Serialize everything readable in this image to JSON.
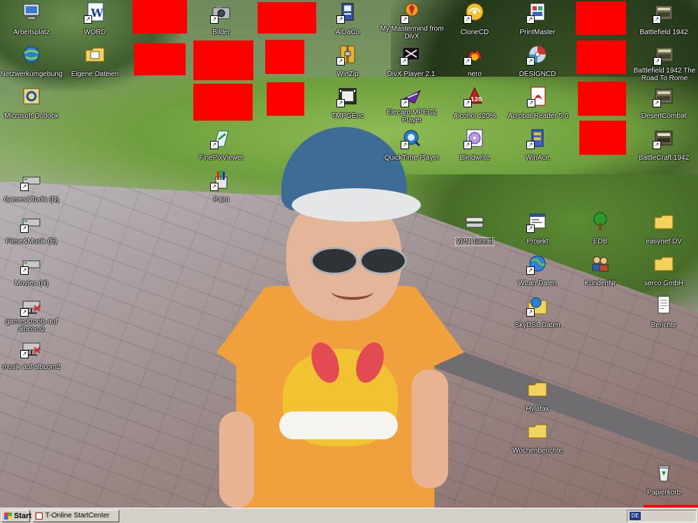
{
  "desktop": {
    "icons": [
      {
        "id": "arbeitsplatz",
        "label": "Arbeitsplatz",
        "icon": "computer-icon",
        "shortcut": false
      },
      {
        "id": "word",
        "label": "WORD",
        "icon": "word-icon",
        "shortcut": true
      },
      {
        "id": "bilder",
        "label": "Bilder",
        "icon": "camera-icon",
        "shortcut": true
      },
      {
        "id": "aldaco",
        "label": "AlDaCo",
        "icon": "app-icon",
        "shortcut": true
      },
      {
        "id": "mastermind",
        "label": "My Mastermind from DivX",
        "icon": "mastermind-icon",
        "shortcut": true
      },
      {
        "id": "clonecd",
        "label": "CloneCD",
        "icon": "clonecd-icon",
        "shortcut": true
      },
      {
        "id": "printmaster",
        "label": "PrintMaster",
        "icon": "printmaster-icon",
        "shortcut": true
      },
      {
        "id": "battlefield1942",
        "label": "Battlefield 1942",
        "icon": "game-icon",
        "shortcut": true
      },
      {
        "id": "netzwerk",
        "label": "Netzwerkumgebung",
        "icon": "network-icon",
        "shortcut": false
      },
      {
        "id": "eigene",
        "label": "Eigene Dateien",
        "icon": "folder-documents-icon",
        "shortcut": false
      },
      {
        "id": "winzip",
        "label": "WinZip",
        "icon": "winzip-icon",
        "shortcut": true
      },
      {
        "id": "divxplayer",
        "label": "DivX Player 2.1",
        "icon": "divx-player-icon",
        "shortcut": true
      },
      {
        "id": "nero",
        "label": "nero",
        "icon": "nero-icon",
        "shortcut": true
      },
      {
        "id": "designcd",
        "label": "DESIGNCD",
        "icon": "cd-icon",
        "shortcut": true
      },
      {
        "id": "bf_road",
        "label": "Battlefield 1942 The Road To Rome",
        "icon": "game-icon",
        "shortcut": true
      },
      {
        "id": "outlook",
        "label": "Microsoft Outlook",
        "icon": "outlook-icon",
        "shortcut": false
      },
      {
        "id": "tmpgenc",
        "label": "TMPGEnc",
        "icon": "film-icon",
        "shortcut": true
      },
      {
        "id": "elecard",
        "label": "Elecard MPEG2 Player",
        "icon": "elecard-icon",
        "shortcut": true
      },
      {
        "id": "alcohol",
        "label": "Alcohol 120%",
        "icon": "alcohol-icon",
        "shortcut": true
      },
      {
        "id": "acrobat",
        "label": "Acrobat Reader 5.0",
        "icon": "acrobat-icon",
        "shortcut": true
      },
      {
        "id": "desertcombat",
        "label": "DesertCombat",
        "icon": "game-icon",
        "shortcut": true
      },
      {
        "id": "finepix",
        "label": "FinePixViewer",
        "icon": "finepix-icon",
        "shortcut": true
      },
      {
        "id": "quicktime",
        "label": "QuickTime Player",
        "icon": "quicktime-icon",
        "shortcut": true
      },
      {
        "id": "blindwrite",
        "label": "Blindwrite",
        "icon": "blindwrite-icon",
        "shortcut": true
      },
      {
        "id": "winace",
        "label": "WinAce",
        "icon": "winace-icon",
        "shortcut": true
      },
      {
        "id": "battlecraft",
        "label": "BattleCraft 1942",
        "icon": "game-icon",
        "shortcut": true
      },
      {
        "id": "paint",
        "label": "Paint",
        "icon": "paint-icon",
        "shortcut": true
      },
      {
        "id": "gamestools",
        "label": "Games&Tools (D)",
        "icon": "drive-icon",
        "shortcut": true
      },
      {
        "id": "vpn",
        "label": "VPN Tunnel",
        "icon": "vpn-icon",
        "shortcut": false
      },
      {
        "id": "projekt",
        "label": "Projekt",
        "icon": "window-icon",
        "shortcut": true
      },
      {
        "id": "edb",
        "label": "EDB",
        "icon": "tree-icon",
        "shortcut": false
      },
      {
        "id": "easynet",
        "label": "easynet DV",
        "icon": "folder-icon",
        "shortcut": false
      },
      {
        "id": "filmemusik",
        "label": "Filme&Musik (E)",
        "icon": "drive-icon",
        "shortcut": true
      },
      {
        "id": "wlan",
        "label": "WLan Daten",
        "icon": "globe-icon",
        "shortcut": true
      },
      {
        "id": "kundennr",
        "label": "KundenNr",
        "icon": "users-icon",
        "shortcut": false
      },
      {
        "id": "serco",
        "label": "serco GmbH",
        "icon": "folder-icon",
        "shortcut": false
      },
      {
        "id": "movies",
        "label": "Movies (H)",
        "icon": "drive-icon",
        "shortcut": true
      },
      {
        "id": "skydsl",
        "label": "SkyDSL Daten",
        "icon": "globe-folder-icon",
        "shortcut": true
      },
      {
        "id": "berichte",
        "label": "Berichte",
        "icon": "document-icon",
        "shortcut": false
      },
      {
        "id": "gamestools2",
        "label": "games&tools auf albcom2",
        "icon": "network-drive-icon",
        "shortcut": true
      },
      {
        "id": "musik",
        "label": "musik auf albcom2",
        "icon": "network-drive-icon",
        "shortcut": true
      },
      {
        "id": "hylafax",
        "label": "Hylafax",
        "icon": "folder-icon",
        "shortcut": false
      },
      {
        "id": "wochenberichte",
        "label": "Wochenberichte",
        "icon": "folder-icon",
        "shortcut": false
      },
      {
        "id": "papierkorb",
        "label": "Papierkorb",
        "icon": "recycle-bin-icon",
        "shortcut": false
      }
    ],
    "selected_icon": "vpn"
  },
  "taskbar": {
    "start_label": "Start",
    "tasks": [
      {
        "label": "T-Online StartCenter",
        "icon": "t-online-icon"
      }
    ],
    "language": "DE"
  },
  "colors": {
    "redaction": "#ff0000",
    "taskbar": "#d4d0c8",
    "icon_text": "#ffffff"
  }
}
